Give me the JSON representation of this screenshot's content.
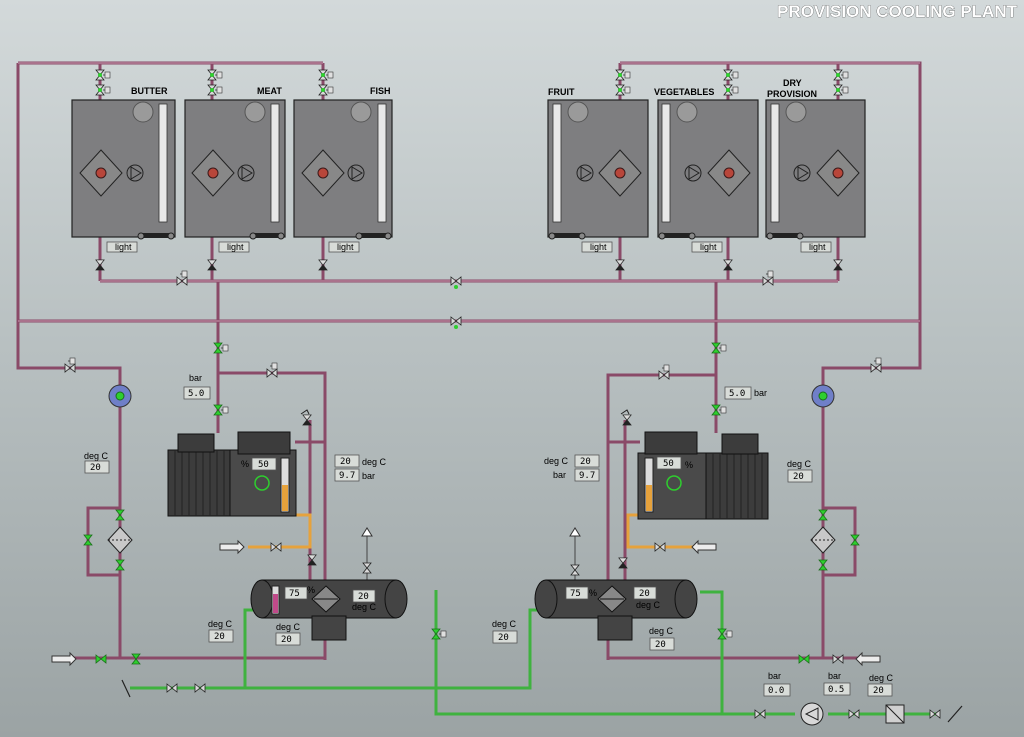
{
  "title": "PROVISION COOLING PLANT",
  "rooms": [
    {
      "label": "BUTTER",
      "light": "light"
    },
    {
      "label": "MEAT",
      "light": "light"
    },
    {
      "label": "FISH",
      "light": "light"
    },
    {
      "label": "FRUIT",
      "light": "light"
    },
    {
      "label": "VEGETABLES",
      "light": "light"
    },
    {
      "label": "DRY",
      "label2": "PROVISION",
      "light": "light"
    }
  ],
  "left": {
    "bar_label": "bar",
    "bar_value": "5.0",
    "comp_pct_unit": "%",
    "comp_pct": "50",
    "disch_temp": "20",
    "disch_temp_unit": "deg C",
    "disch_press": "9.7",
    "disch_press_unit": "bar",
    "inlet_label": "deg C",
    "inlet_temp": "20",
    "cond_pct": "75",
    "cond_pct_unit": "%",
    "cond_temp": "20",
    "cond_temp_unit": "deg C",
    "cw_in_label": "deg C",
    "cw_in_temp": "20",
    "cw_out_label": "deg C",
    "cw_out_temp": "20"
  },
  "right": {
    "bar_label": "bar",
    "bar_value": "5.0",
    "comp_pct_unit": "%",
    "comp_pct": "50",
    "disch_temp": "20",
    "disch_temp_unit": "deg C",
    "disch_press": "9.7",
    "disch_press_unit": "bar",
    "inlet_label": "deg C",
    "inlet_temp": "20",
    "cond_pct": "75",
    "cond_pct_unit": "%",
    "cond_temp": "20",
    "cond_temp_unit": "deg C",
    "cw_in_label": "deg C",
    "cw_in_temp": "20",
    "cw_out_label": "deg C",
    "cw_out_temp": "20"
  },
  "pump": {
    "suction_label": "bar",
    "suction_value": "0.0",
    "discharge_label": "bar",
    "discharge_value": "0.5",
    "temp_label": "deg C",
    "temp_value": "20"
  },
  "colors": {
    "refrigerant_pipe": "#8a4a68",
    "cooling_water_pipe": "#3fb23f",
    "oil_pipe": "#e6a23c",
    "valve_open": "#2ecf2e",
    "fan_light": "#b8463a"
  }
}
